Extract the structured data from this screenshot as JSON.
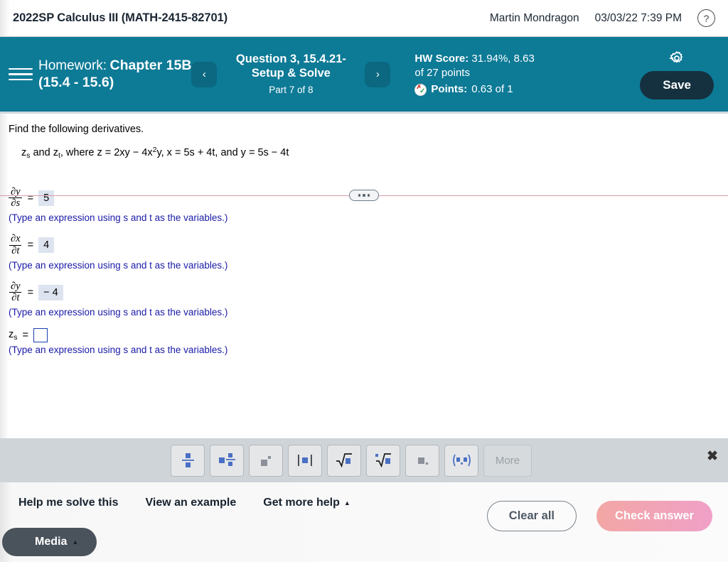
{
  "topbar": {
    "course_title": "2022SP Calculus III (MATH-2415-82701)",
    "user_name": "Martin Mondragon",
    "date_time": "03/03/22 7:39 PM",
    "help_icon": "?"
  },
  "header": {
    "homework_label": "Homework:",
    "homework_name": "Chapter 15B",
    "homework_range": "(15.4 - 15.6)",
    "prev_arrow": "‹",
    "next_arrow": "›",
    "question_title": "Question 3, 15.4.21-Setup & Solve",
    "question_part": "Part 7 of 8",
    "hw_score_label": "HW Score:",
    "hw_score_value": "31.94%, 8.63",
    "hw_score_line2": "of 27 points",
    "points_label": "Points:",
    "points_value": "0.63 of 1",
    "save_label": "Save",
    "teal_color": "#0d7a96",
    "save_color": "#15313f"
  },
  "problem": {
    "prompt": "Find the following derivatives.",
    "equation_prefix": "z",
    "equation_sub1": "s",
    "equation_mid": " and z",
    "equation_sub2": "t",
    "equation_rest": ", where z = 2xy − 4x",
    "equation_exp": "2",
    "equation_tail": "y, x = 5s + 4t, and y = 5s − 4t"
  },
  "answers": {
    "hint_text": "(Type an expression using s and t as the variables.)",
    "rows": [
      {
        "num": "∂y",
        "den": "∂s",
        "eq": "=",
        "value": "5",
        "filled": true
      },
      {
        "num": "∂x",
        "den": "∂t",
        "eq": "=",
        "value": "4",
        "filled": true
      },
      {
        "num": "∂y",
        "den": "∂t",
        "eq": "=",
        "value": "− 4",
        "filled": true
      }
    ],
    "final_row": {
      "label": "z",
      "sub": "s",
      "eq": "=",
      "value": "",
      "filled": false
    }
  },
  "math_toolbar": {
    "buttons": [
      {
        "name": "fraction-button",
        "glyph": "fraction"
      },
      {
        "name": "mixed-number-button",
        "glyph": "mixed"
      },
      {
        "name": "exponent-button",
        "glyph": "exponent"
      },
      {
        "name": "absolute-value-button",
        "glyph": "abs"
      },
      {
        "name": "square-root-button",
        "glyph": "sqrt"
      },
      {
        "name": "nth-root-button",
        "glyph": "nthroot"
      },
      {
        "name": "decimal-button",
        "glyph": "decimal"
      },
      {
        "name": "ordered-pair-button",
        "glyph": "pair"
      }
    ],
    "more_label": "More",
    "close_label": "✖"
  },
  "bottom": {
    "help_me_solve": "Help me solve this",
    "view_example": "View an example",
    "get_more_help": "Get more help",
    "caret": "▲",
    "media_label": "Media",
    "clear_all": "Clear all",
    "check_answer": "Check answer"
  }
}
